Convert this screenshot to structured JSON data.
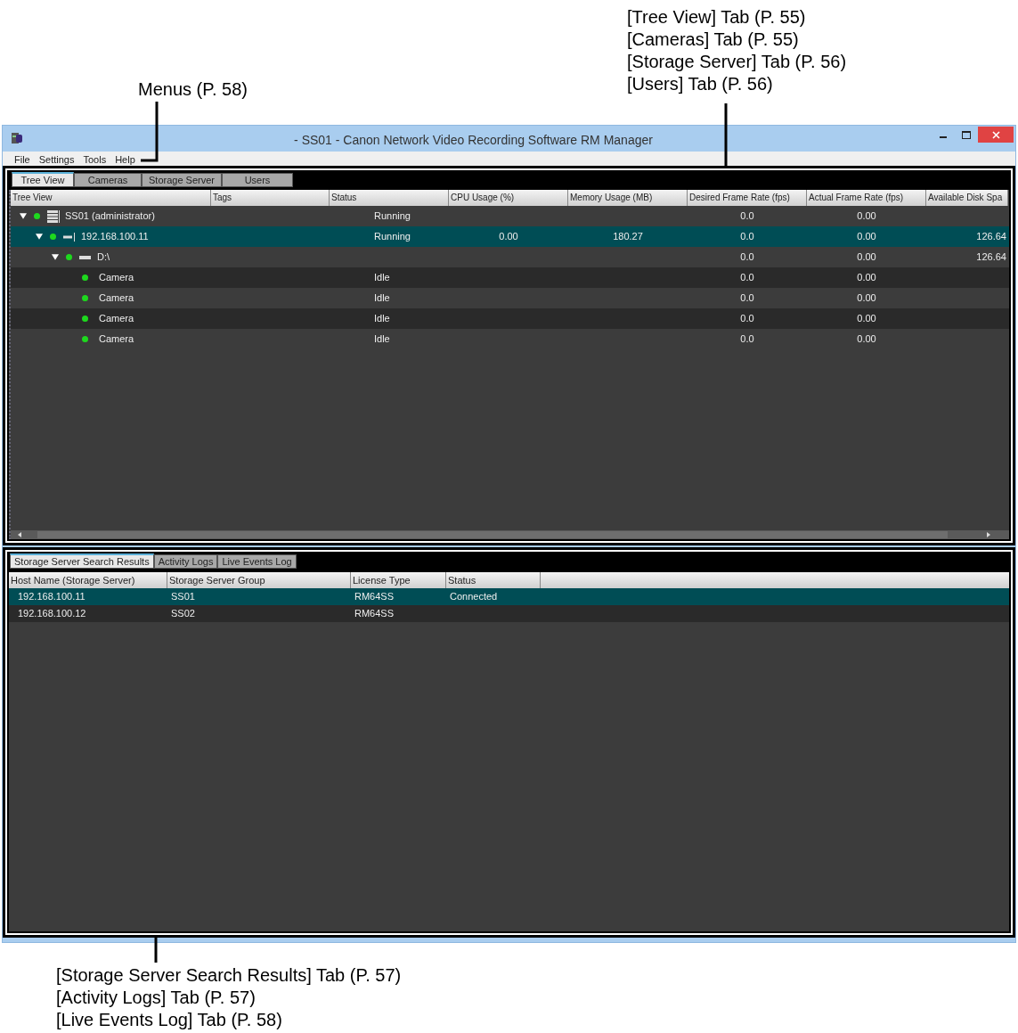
{
  "callouts": {
    "menus": "Menus (P. 58)",
    "tabs_top": [
      "[Tree View] Tab (P. 55)",
      "[Cameras] Tab (P. 55)",
      "[Storage Server] Tab (P. 56)",
      "[Users] Tab (P. 56)"
    ],
    "tabs_bottom": [
      "[Storage Server Search Results] Tab (P. 57)",
      "[Activity Logs] Tab (P. 57)",
      "[Live Events Log] Tab (P. 58)"
    ]
  },
  "window": {
    "title": "- SS01 - Canon Network Video Recording Software RM Manager"
  },
  "menu": [
    "File",
    "Settings",
    "Tools",
    "Help"
  ],
  "upper_tabs": [
    {
      "label": "Tree View",
      "selected": true
    },
    {
      "label": "Cameras",
      "selected": false
    },
    {
      "label": "Storage Server",
      "selected": false
    },
    {
      "label": "Users",
      "selected": false
    }
  ],
  "tree_table": {
    "columns": [
      "Tree View",
      "Tags",
      "Status",
      "CPU Usage (%)",
      "Memory Usage (MB)",
      "Desired Frame Rate (fps)",
      "Actual Frame Rate (fps)",
      "Available Disk Spa"
    ],
    "rows": [
      {
        "kind": "server",
        "name": "SS01 (administrator)",
        "expanded": true,
        "selected": false,
        "status": "Running",
        "desired": "0.0",
        "actual": "0.00",
        "children": [
          {
            "kind": "host",
            "name": "192.168.100.11",
            "expanded": true,
            "selected": true,
            "status": "Running",
            "cpu": "0.00",
            "memory": "180.27",
            "desired": "0.0",
            "actual": "0.00",
            "disk": "126.64",
            "children": [
              {
                "kind": "drive",
                "name": "D:\\",
                "expanded": true,
                "selected": false,
                "desired": "0.0",
                "actual": "0.00",
                "disk": "126.64",
                "children": [
                  {
                    "kind": "camera",
                    "name": "Camera",
                    "selected": false,
                    "status": "Idle",
                    "desired": "0.0",
                    "actual": "0.00"
                  },
                  {
                    "kind": "camera",
                    "name": "Camera",
                    "selected": false,
                    "status": "Idle",
                    "desired": "0.0",
                    "actual": "0.00"
                  },
                  {
                    "kind": "camera",
                    "name": "Camera",
                    "selected": false,
                    "status": "Idle",
                    "desired": "0.0",
                    "actual": "0.00"
                  },
                  {
                    "kind": "camera",
                    "name": "Camera",
                    "selected": false,
                    "status": "Idle",
                    "desired": "0.0",
                    "actual": "0.00"
                  }
                ]
              }
            ]
          }
        ]
      }
    ]
  },
  "lower_tabs": [
    {
      "label": "Storage Server Search Results",
      "selected": true
    },
    {
      "label": "Activity Logs",
      "selected": false
    },
    {
      "label": "Live Events Log",
      "selected": false
    }
  ],
  "results_table": {
    "columns": [
      "Host Name (Storage Server)",
      "Storage Server Group",
      "License Type",
      "Status"
    ],
    "rows": [
      {
        "selected": true,
        "cells": [
          "192.168.100.11",
          "SS01",
          "RM64SS",
          "Connected"
        ]
      },
      {
        "selected": false,
        "cells": [
          "192.168.100.12",
          "SS02",
          "RM64SS",
          ""
        ]
      }
    ]
  }
}
